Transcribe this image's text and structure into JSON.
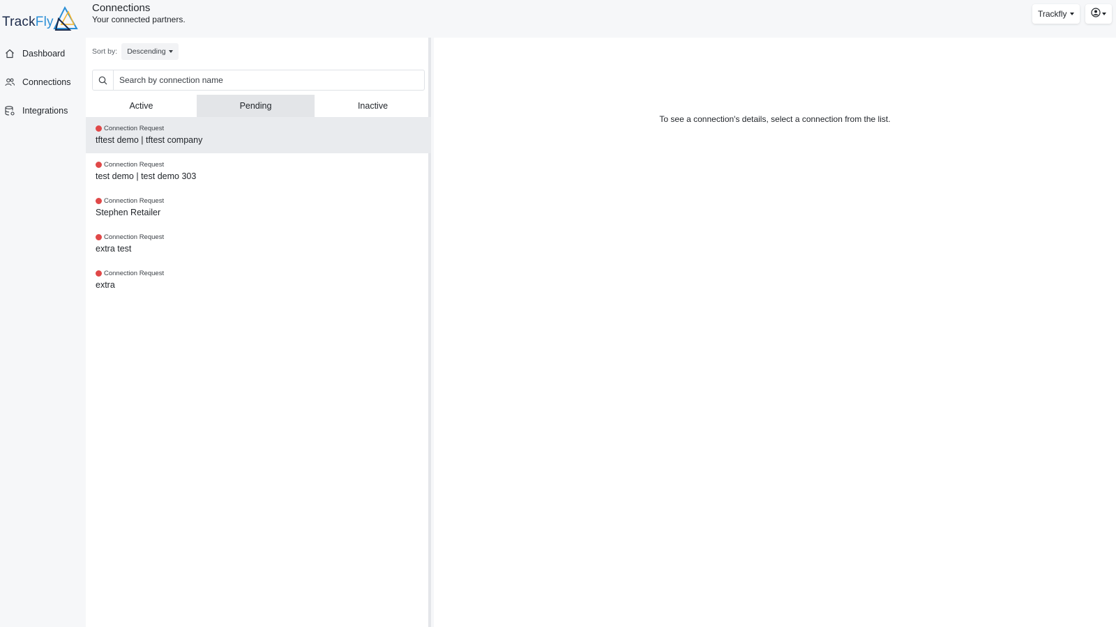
{
  "brand": {
    "part1": "Track",
    "part2": "Fly"
  },
  "sidebar": {
    "items": [
      {
        "label": "Dashboard",
        "icon": "home-icon"
      },
      {
        "label": "Connections",
        "icon": "users-icon"
      },
      {
        "label": "Integrations",
        "icon": "database-settings-icon"
      }
    ]
  },
  "header": {
    "title": "Connections",
    "subtitle": "Your connected partners.",
    "org_label": "Trackfly"
  },
  "list": {
    "sort_label": "Sort by:",
    "sort_value": "Descending",
    "search_placeholder": "Search by connection name",
    "tabs": [
      "Active",
      "Pending",
      "Inactive"
    ],
    "active_tab": "Pending",
    "items": [
      {
        "status": "Connection Request",
        "name": "tftest demo | tftest company",
        "selected": true
      },
      {
        "status": "Connection Request",
        "name": "test demo | test demo 303",
        "selected": false
      },
      {
        "status": "Connection Request",
        "name": "Stephen Retailer",
        "selected": false
      },
      {
        "status": "Connection Request",
        "name": "extra test",
        "selected": false
      },
      {
        "status": "Connection Request",
        "name": "extra",
        "selected": false
      }
    ]
  },
  "detail": {
    "empty_message": "To see a connection's details, select a connection from the list."
  },
  "colors": {
    "status_dot": "#e04848",
    "logo_blue": "#2b8fd6",
    "logo_navy": "#1b2a4a",
    "logo_yellow": "#f2b632"
  }
}
